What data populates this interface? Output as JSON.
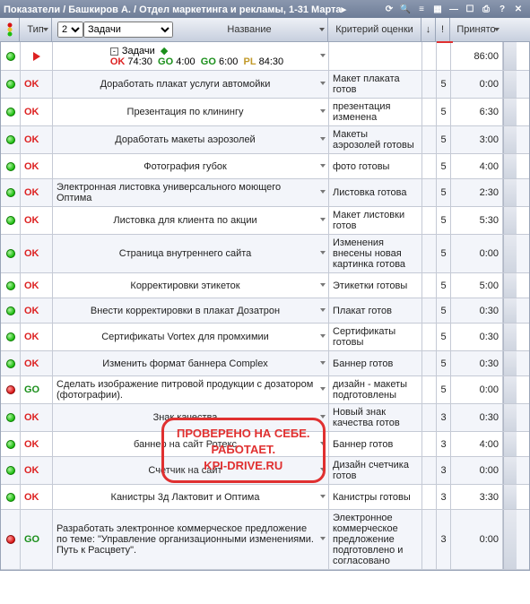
{
  "titlebar": {
    "text": "Показатели / Башкиров А. / Отдел маркетинга и рекламы, 1-31 Марта▸"
  },
  "headers": {
    "tip": "Тип",
    "name": "Название",
    "criterion": "Критерий оценки",
    "arrow": "↓",
    "bang": "!",
    "accepted": "Принято",
    "level_options": [
      "2"
    ],
    "level_selected": "2",
    "task_options": [
      "Задачи"
    ],
    "task_selected": "Задачи"
  },
  "summary": {
    "label": "Задачи",
    "seg1_lbl": "OK",
    "seg1_val": "74:30",
    "seg2_lbl": "GO",
    "seg2_val": "4:00",
    "seg3_lbl": "GO",
    "seg3_val": "6:00",
    "seg4_lbl": "PL",
    "seg4_val": "84:30",
    "accepted": "86:00"
  },
  "rows": [
    {
      "light": "green",
      "tip": "OK",
      "name": "Доработать плакат услуги автомойки",
      "crit": "Макет плаката готов",
      "num": "5",
      "acc": "0:00"
    },
    {
      "light": "green",
      "tip": "OK",
      "name": "Презентация по клинингу",
      "crit": "презентация изменена",
      "num": "5",
      "acc": "6:30"
    },
    {
      "light": "green",
      "tip": "OK",
      "name": "Доработать макеты аэрозолей",
      "crit": "Макеты аэрозолей готовы",
      "num": "5",
      "acc": "3:00"
    },
    {
      "light": "green",
      "tip": "OK",
      "name": "Фотография губок",
      "crit": "фото готовы",
      "num": "5",
      "acc": "4:00"
    },
    {
      "light": "green",
      "tip": "OK",
      "name": "Электронная листовка универсального моющего Оптима",
      "crit": "Листовка готова",
      "num": "5",
      "acc": "2:30"
    },
    {
      "light": "green",
      "tip": "OK",
      "name": "Листовка для клиента по акции",
      "crit": "Макет листовки готов",
      "num": "5",
      "acc": "5:30"
    },
    {
      "light": "green",
      "tip": "OK",
      "name": "Страница внутреннего сайта",
      "crit": "Изменения внесены новая картинка готова",
      "num": "5",
      "acc": "0:00"
    },
    {
      "light": "green",
      "tip": "OK",
      "name": "Корректировки этикеток",
      "crit": "Этикетки готовы",
      "num": "5",
      "acc": "5:00"
    },
    {
      "light": "green",
      "tip": "OK",
      "name": "Внести корректировки в плакат Дозатрон",
      "crit": "Плакат готов",
      "num": "5",
      "acc": "0:30"
    },
    {
      "light": "green",
      "tip": "OK",
      "name": "Сертификаты Vortex для промхимии",
      "crit": "Сертификаты готовы",
      "num": "5",
      "acc": "0:30"
    },
    {
      "light": "green",
      "tip": "OK",
      "name": "Изменить формат баннера Complex",
      "crit": "Баннер готов",
      "num": "5",
      "acc": "0:30"
    },
    {
      "light": "red",
      "tip": "GO",
      "name": "Сделать изображение питровой продукции с дозатором (фотографии).",
      "crit": "дизайн - макеты подготовлены",
      "num": "5",
      "acc": "0:00"
    },
    {
      "light": "green",
      "tip": "OK",
      "name": "Знак качества",
      "crit": "Новый знак качества готов",
      "num": "3",
      "acc": "0:30"
    },
    {
      "light": "green",
      "tip": "OK",
      "name": "баннер на сайт Ротекс",
      "crit": "Баннер готов",
      "num": "3",
      "acc": "4:00"
    },
    {
      "light": "green",
      "tip": "OK",
      "name": "Счетчик на сайт",
      "crit": "Дизайн счетчика готов",
      "num": "3",
      "acc": "0:00"
    },
    {
      "light": "green",
      "tip": "OK",
      "name": "Канистры 3д Лактовит и Оптима",
      "crit": "Канистры готовы",
      "num": "3",
      "acc": "3:30"
    },
    {
      "light": "red",
      "tip": "GO",
      "name": "Разработать электронное коммерческое предложение по теме: \"Управление организационными изменениями. Путь к Расцвету\".",
      "crit": "Электронное коммерческое предложение подготовлено и согласовано",
      "num": "3",
      "acc": "0:00"
    }
  ],
  "watermark": {
    "line1": "ПРОВЕРЕНО НА СЕБЕ.",
    "line2": "РАБОТАЕТ.",
    "line3": "KPI-DRIVE.RU"
  }
}
